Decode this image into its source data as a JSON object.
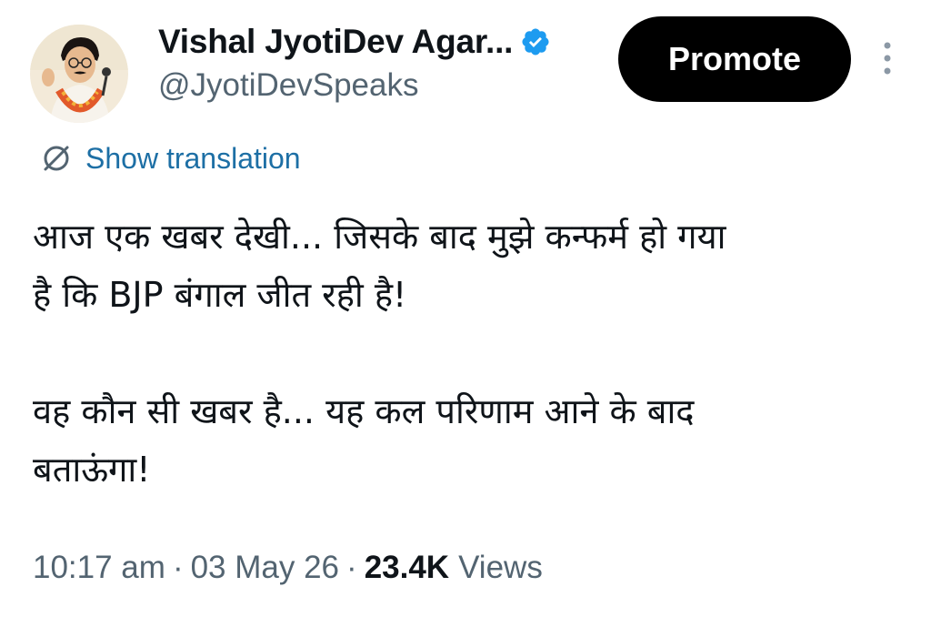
{
  "author": {
    "display_name": "Vishal JyotiDev Agar...",
    "handle": "@JyotiDevSpeaks",
    "verified": true
  },
  "actions": {
    "promote_label": "Promote"
  },
  "translation": {
    "label": "Show translation"
  },
  "tweet": {
    "paragraph_1_line_1": "आज एक खबर देखी... जिसके बाद मुझे कन्फर्म हो गया",
    "paragraph_1_line_2": "है कि BJP बंगाल जीत रही है!",
    "paragraph_2_line_1": "वह कौन सी खबर है... यह कल परिणाम आने के बाद",
    "paragraph_2_line_2": "बताऊंगा!"
  },
  "meta": {
    "time": "10:17 am",
    "separator": "·",
    "date": "03 May 26",
    "views_count": "23.4K",
    "views_label": "Views"
  },
  "colors": {
    "text_primary": "#0f1419",
    "text_secondary": "#536471",
    "link": "#1d6fa5",
    "verified": "#1d9bf0",
    "promote_bg": "#000000"
  },
  "icons": {
    "verified": "verified-badge-icon",
    "more": "more-vertical-icon",
    "translate": "translate-icon"
  }
}
